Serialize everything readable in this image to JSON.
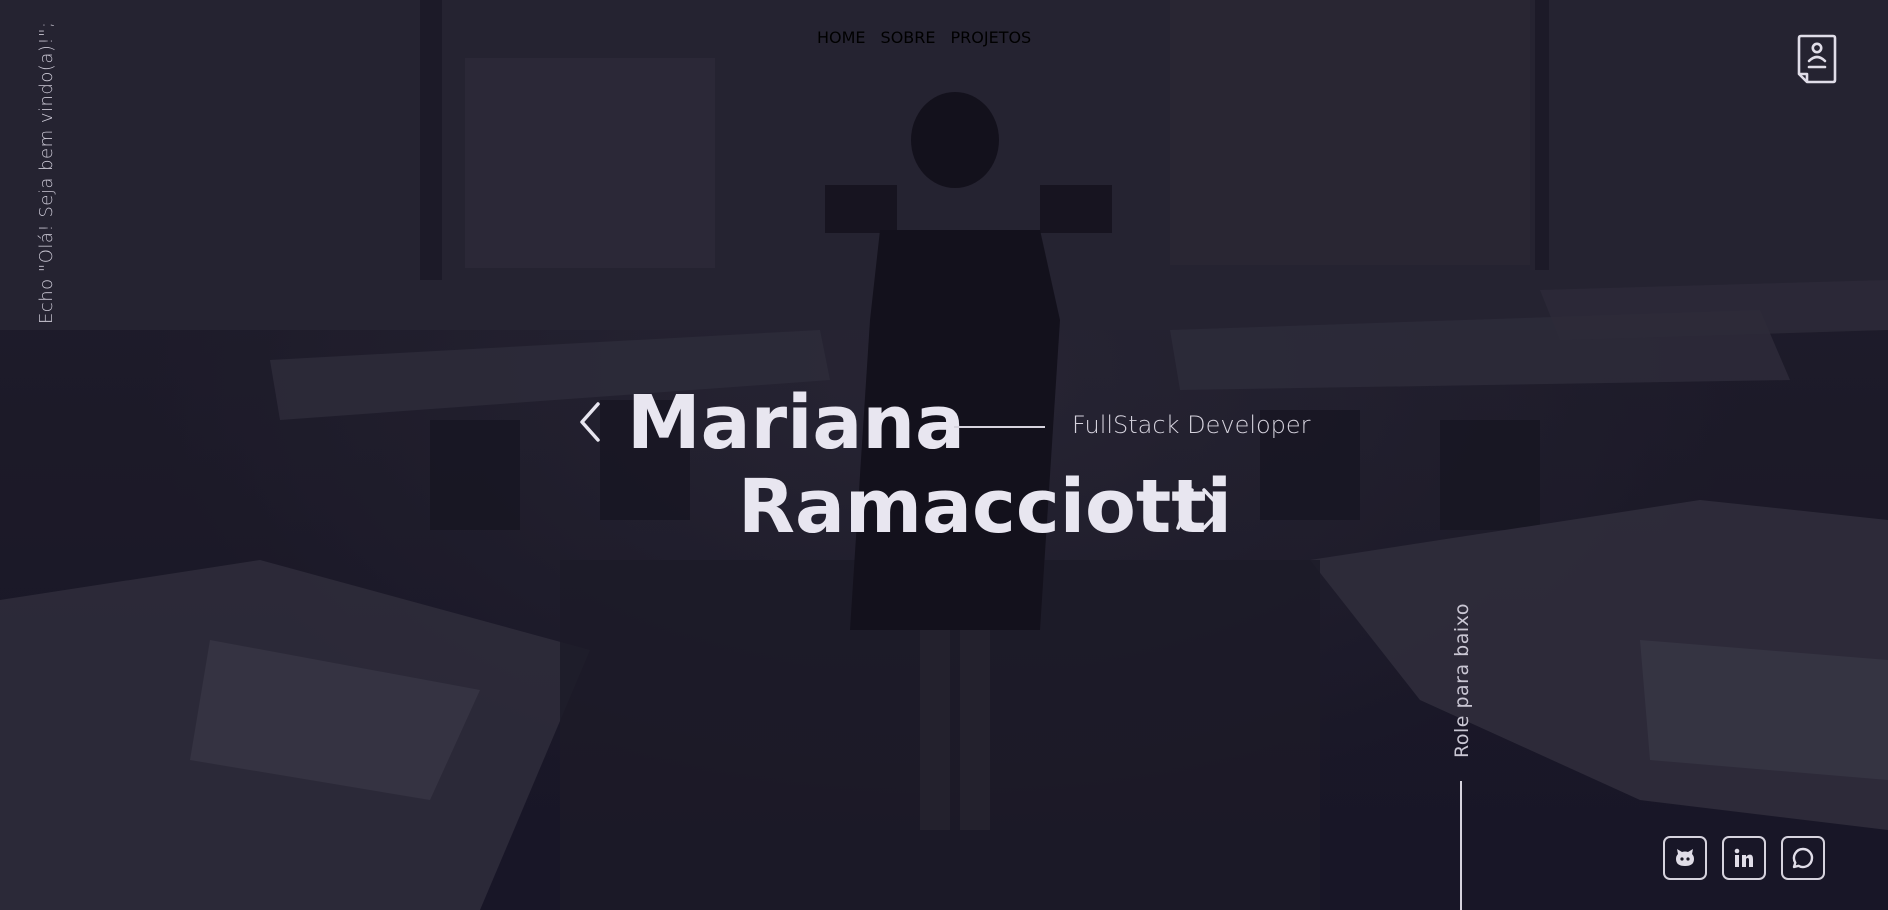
{
  "nav": {
    "items": [
      {
        "label": "HOME"
      },
      {
        "label": "SOBRE"
      },
      {
        "label": "PROJETOS"
      }
    ]
  },
  "side": {
    "greeting": "Echo \"Olá! Seja bem vindo(a)!\";",
    "scroll_hint": "Role para baixo"
  },
  "hero": {
    "first_name": "Mariana",
    "last_name": "Ramacciotti",
    "role": "FullStack Developer"
  },
  "icons": {
    "cv": "resume-icon",
    "github": "github-icon",
    "linkedin": "linkedin-icon",
    "whatsapp": "whatsapp-icon"
  },
  "colors": {
    "background": "#1b1926",
    "text": "#e8e6f0",
    "muted_text": "#c9c6d3",
    "accent_line": "#d6d3de"
  }
}
